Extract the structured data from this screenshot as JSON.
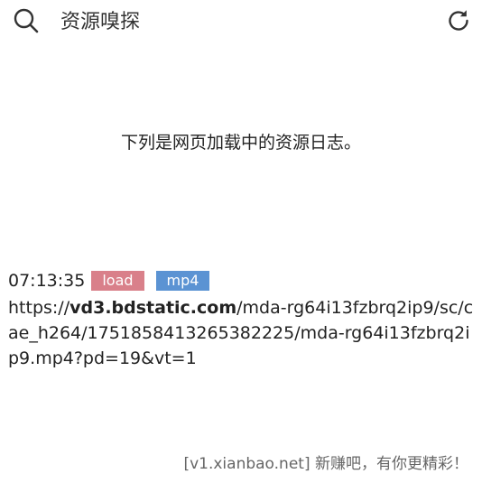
{
  "header": {
    "title": "资源嗅探",
    "search_icon": "search-icon",
    "refresh_icon": "refresh-icon"
  },
  "notice": "下列是网页加载中的资源日志。",
  "log_entries": [
    {
      "time": "07:13:35",
      "event": "load",
      "type": "mp4",
      "url_scheme": "https://",
      "url_host": "vd3.bdstatic.com",
      "url_path": "/mda-rg64i13fzbrq2ip9/sc/cae_h264/1751858413265382225/mda-rg64i13fzbrq2ip9.mp4?pd=19&vt=1"
    }
  ],
  "footer": "[v1.xianbao.net] 新赚吧，有你更精彩！",
  "colors": {
    "event_badge": "#d9808a",
    "type_badge": "#5b93d3"
  }
}
